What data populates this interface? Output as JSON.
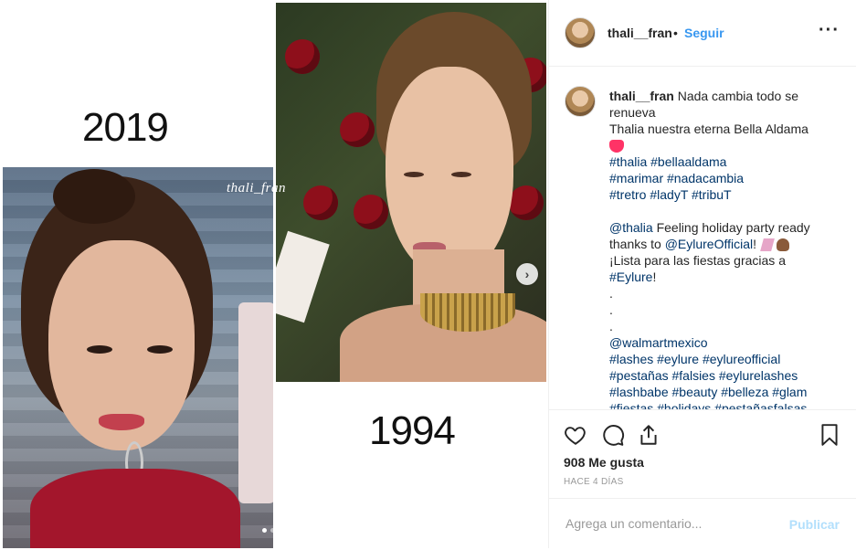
{
  "media": {
    "year_left": "2019",
    "year_right": "1994",
    "watermark": "thali_fran",
    "next_arrow": "›",
    "carousel_slide_count": 2,
    "carousel_active_index": 0
  },
  "header": {
    "username": "thali__fran",
    "separator": "•",
    "follow_label": "Seguir",
    "more_label": "···",
    "avatar_icon": "profile-avatar"
  },
  "caption": {
    "username": "thali__fran",
    "line1": "Nada cambia todo se renueva",
    "line2": "Thalia nuestra eterna Bella Aldama",
    "line2_emoji": "heart-with-ribbon-emoji",
    "tags1": "#thalia #bellaaldama",
    "tags2": "#marimar #nadacambia",
    "tags3": "#tretro #ladyT #tribuT",
    "mention1": "@thalia",
    "text1": " Feeling holiday party ready thanks to ",
    "mention2": "@EylureOfficial",
    "text2": "!",
    "text2_emojis": [
      "sparkles-emoji",
      "woman-tipping-hand-emoji"
    ],
    "text3": "¡Lista para las fiestas gracias a",
    "tag_eylure": "#Eylure",
    "text4": "!",
    "dots": [
      ".",
      ".",
      "."
    ],
    "mention3": "@walmartmexico",
    "tags4": "#lashes #eylure #eylureofficial",
    "tags5": "#pestañas #falsies #eylurelashes",
    "tags6": "#lashbabe #beauty #belleza #glam",
    "tags7": "#fiestas #holidays #pestañasfalsas"
  },
  "actions": {
    "like_icon": "heart-outline-icon",
    "comment_icon": "comment-bubble-icon",
    "share_icon": "share-upload-icon",
    "save_icon": "bookmark-icon",
    "likes": "908 Me gusta",
    "time_ago": "HACE 4 DÍAS"
  },
  "comment": {
    "placeholder": "Agrega un comentario...",
    "value": "",
    "post_label": "Publicar"
  },
  "colors": {
    "accent": "#3897f0",
    "tag": "#003569",
    "post_disabled": "#b2dffc",
    "muted": "#999999",
    "border": "#efefef"
  }
}
